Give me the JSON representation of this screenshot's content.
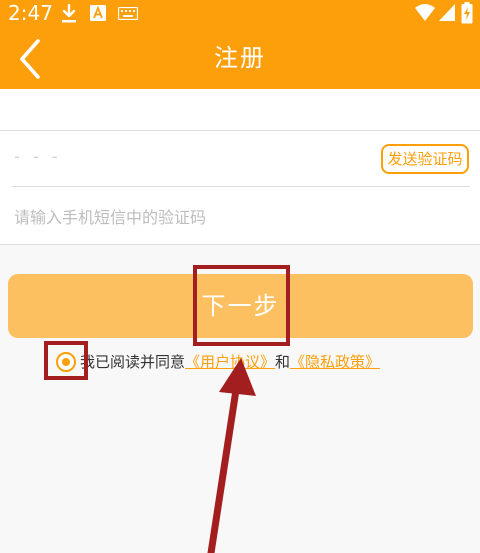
{
  "status_bar": {
    "time": "2:47",
    "icons": [
      "download-icon",
      "a-letter-icon",
      "keyboard-icon",
      "wifi-icon",
      "signal-icon",
      "battery-charging-icon"
    ]
  },
  "navbar": {
    "back_icon": "chevron-left-icon",
    "title": "注册"
  },
  "form": {
    "phone_placeholder": "- - -",
    "send_code_label": "发送验证码",
    "code_placeholder": "请输入手机短信中的验证码"
  },
  "next_button": {
    "label": "下一步"
  },
  "agreement": {
    "checked": true,
    "prefix": "我已阅读并同意",
    "user_agreement": "《用户协议》",
    "conjunction": "和",
    "privacy_policy": "《隐私政策》"
  },
  "colors": {
    "brand_orange": "#fd9f0a",
    "button_disabled": "#fdc061",
    "annotation_red": "#a31e1e"
  }
}
